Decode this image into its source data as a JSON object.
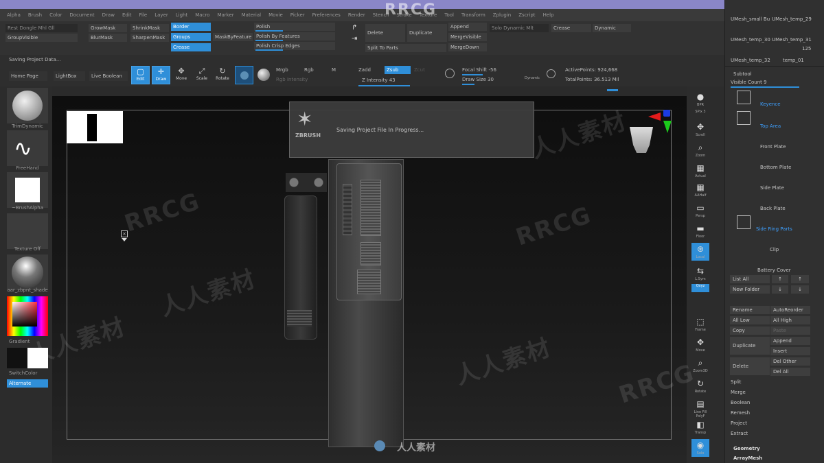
{
  "menu": [
    "Alpha",
    "Brush",
    "Color",
    "Document",
    "Draw",
    "Edit",
    "File",
    "Layer",
    "Light",
    "Macro",
    "Marker",
    "Material",
    "Movie",
    "Picker",
    "Preferences",
    "Render",
    "Stencil",
    "Stroke",
    "Texture",
    "Tool",
    "Transform",
    "Zplugin",
    "Zscript",
    "Help"
  ],
  "shelf": {
    "col1": [
      "Rest Dongle Mhl Gll",
      "GroupVisible"
    ],
    "col2": [
      "GrowMask",
      "BlurMask"
    ],
    "col3": [
      "ShrinkMask",
      "SharpenMask"
    ],
    "col4": [
      "Border",
      "Groups",
      "Crease"
    ],
    "maskbyfeature": "MaskByFeature",
    "polish": [
      "Polish",
      "Polish By Features",
      "Polish Crisp Edges"
    ],
    "delete": "Delete",
    "duplicate": "Duplicate",
    "split_to_parts": "Split To Parts",
    "append": [
      "Append",
      "MergeVisible",
      "MergeDown"
    ],
    "solo_dynamic": "Solo Dynamic Mlt",
    "crease": "Crease",
    "dynamic": "Dynamic"
  },
  "toolrow": {
    "status": "Saving Project Data...",
    "left_buttons": [
      "Home Page",
      "LightBox",
      "Live Boolean"
    ],
    "modes": [
      {
        "label": "Edit",
        "icon": "▢",
        "active": true
      },
      {
        "label": "Draw",
        "icon": "✛",
        "active": true
      },
      {
        "label": "Move",
        "icon": "✥",
        "active": false
      },
      {
        "label": "Scale",
        "icon": "⤢",
        "active": false
      },
      {
        "label": "Rotate",
        "icon": "↻",
        "active": false
      }
    ],
    "mrgb": "Mrgb",
    "rgb": "Rgb",
    "m": "M",
    "zadd": "Zadd",
    "zsub": "Zsub",
    "zcut": "Zcut",
    "rgb_intensity": "Rgb Intensity",
    "z_intensity": "Z Intensity 43",
    "focal_shift": "Focal Shift -56",
    "draw_size": "Draw Size 30",
    "dynamic": "Dynamic",
    "active_points": "ActivePoints: 924,668",
    "total_points": "TotalPoints: 36.513 Mil"
  },
  "left": {
    "brush": "TrimDynamic",
    "stroke": "FreeHand",
    "alpha": "~BrushAlpha",
    "texture": "Texture Off",
    "material": "aar_zbpnt_shade",
    "gradient": "Gradient",
    "switch": "SwitchColor",
    "alternate": "Alternate"
  },
  "modal": {
    "logo": "ZBRUSH",
    "message": "Saving Project File In Progress..."
  },
  "rightstrip": [
    {
      "label": "BPR",
      "icon": "●"
    },
    {
      "label": "SPix 3",
      "icon": ""
    },
    {
      "label": "Scroll",
      "icon": "✥"
    },
    {
      "label": "Zoom",
      "icon": "⌕"
    },
    {
      "label": "Actual",
      "icon": "▦"
    },
    {
      "label": "AAHalf",
      "icon": "▦"
    },
    {
      "label": "Persp",
      "icon": "▭"
    },
    {
      "label": "Floor",
      "icon": "▬"
    },
    {
      "label": "Local",
      "icon": "⊛"
    },
    {
      "label": "L.Sym",
      "icon": "⇆"
    },
    {
      "label": "Qxyz",
      "icon": "▭"
    },
    {
      "label": "Frame",
      "icon": "⬚"
    },
    {
      "label": "Move",
      "icon": "✥"
    },
    {
      "label": "Zoom3D",
      "icon": "⌕"
    },
    {
      "label": "Rotate",
      "icon": "↻"
    },
    {
      "label": "Line Fill PolyF",
      "icon": "▤"
    },
    {
      "label": "Transp",
      "icon": "◧"
    },
    {
      "label": "Solo",
      "icon": "◉"
    }
  ],
  "rpanel": {
    "meshes": [
      "UMesh_small Bu",
      "UMesh_temp_29",
      "UMesh_temp_30",
      "UMesh_temp_31",
      "UMesh_temp_32",
      "temp_01"
    ],
    "meshes_count": "125",
    "subtool": "Subtool",
    "visible_count": "Visible Count 9",
    "subtools": [
      {
        "name": "Keyence",
        "highlight": true
      },
      {
        "name": "Top Area",
        "highlight": true
      },
      {
        "name": "Front Plate",
        "highlight": false
      },
      {
        "name": "Bottom Plate",
        "highlight": false
      },
      {
        "name": "Side Plate",
        "highlight": false
      },
      {
        "name": "Back Plate",
        "highlight": false
      },
      {
        "name": "Side Ring Parts",
        "highlight": true
      },
      {
        "name": "Clip",
        "highlight": false
      },
      {
        "name": "Battery Cover",
        "highlight": false
      }
    ],
    "list_all": "List All",
    "new_folder": "New Folder",
    "rename": "Rename",
    "autoreorder": "AutoReorder",
    "all_low": "All Low",
    "all_high": "All High",
    "copy": "Copy",
    "paste": "Paste",
    "duplicate": "Duplicate",
    "append": "Append",
    "insert": "Insert",
    "delete": "Delete",
    "del_other": "Del Other",
    "del_all": "Del All",
    "actions": [
      "Split",
      "Merge",
      "Boolean",
      "Remesh",
      "Project",
      "Extract"
    ],
    "geometry": "Geometry",
    "arraymesh": "ArrayMesh"
  },
  "watermarks": [
    "RRCG",
    "人人素材",
    "RRCG",
    "人人素材",
    "RRCG",
    "人人素材",
    "RRCG",
    "人人素材"
  ],
  "bottom_brand": "人人素材",
  "colors": {
    "accent": "#2f8fd9",
    "highlight": "#3ea0ff",
    "panel": "#303030"
  }
}
